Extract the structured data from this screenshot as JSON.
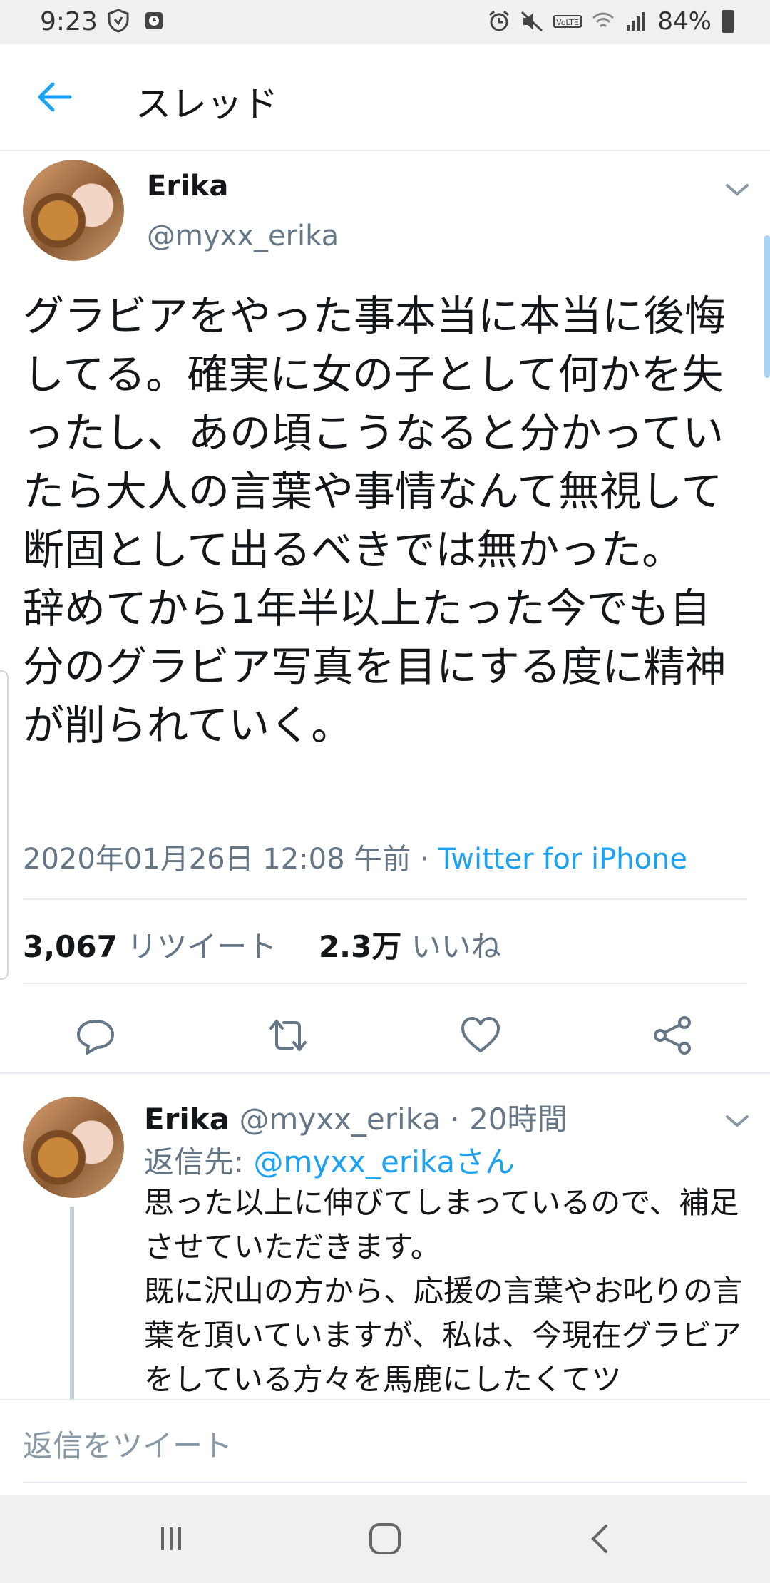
{
  "status_bar": {
    "time": "9:23",
    "battery": "84%",
    "left_icons": [
      "shield-icon",
      "clock-app-icon"
    ],
    "right_icons": [
      "alarm-icon",
      "mute-icon",
      "volte-icon",
      "wifi-icon",
      "signal-icon",
      "battery-icon"
    ]
  },
  "header": {
    "title": "スレッド",
    "back_icon": "back-arrow-icon"
  },
  "main_tweet": {
    "name": "Erika",
    "handle": "@myxx_erika",
    "text": "グラビアをやった事本当に本当に後悔してる。確実に女の子として何かを失ったし、あの頃こうなると分かっていたら大人の言葉や事情なんて無視して断固として出るべきでは無かった。\n辞めてから1年半以上たった今でも自分のグラビア写真を目にする度に精神が削られていく。",
    "timestamp": "2020年01月26日 12:08 午前",
    "separator": " · ",
    "client": "Twitter for iPhone",
    "retweets_count": "3,067",
    "retweets_label": "リツイート",
    "likes_count": "2.3万",
    "likes_label": "いいね",
    "actions": [
      "reply-icon",
      "retweet-icon",
      "like-icon",
      "share-icon"
    ]
  },
  "reply_tweet": {
    "name": "Erika",
    "handle": "@myxx_erika",
    "time_ago": "20時間",
    "reply_to_prefix": "返信先: ",
    "reply_to_mention": "@myxx_erikaさん",
    "text": "思った以上に伸びてしまっているので、補足させていただきます。\n既に沢山の方から、応援の言葉やお叱りの言葉を頂いていますが、私は、今現在グラビアをしている方々を馬鹿にしたくてツ"
  },
  "compose": {
    "placeholder": "返信をツイート"
  },
  "colors": {
    "accent": "#1da1f2",
    "secondary_text": "#657786",
    "divider": "#e6ecf0"
  }
}
